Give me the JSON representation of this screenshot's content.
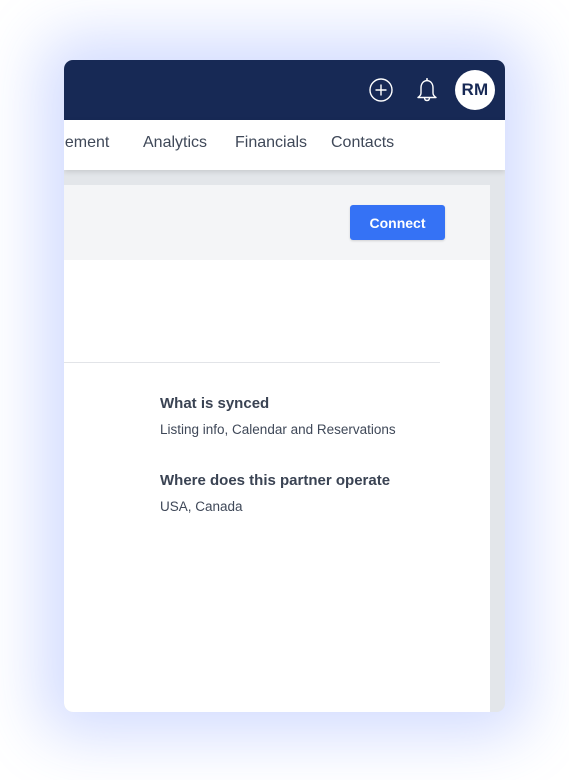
{
  "topbar": {
    "icons": {
      "add": "plus-circle-icon",
      "notifications": "bell-icon"
    },
    "avatar_initials": "RM"
  },
  "nav": {
    "items": [
      {
        "label": "gement"
      },
      {
        "label": "Analytics"
      },
      {
        "label": "Financials"
      },
      {
        "label": "Contacts"
      }
    ]
  },
  "panel": {
    "connect_label": "Connect",
    "details": [
      {
        "label": "What is synced",
        "value": "Listing info, Calendar and Reservations"
      },
      {
        "label": "Where does this partner operate",
        "value": "USA, Canada"
      }
    ]
  },
  "colors": {
    "topbar_bg": "#172955",
    "accent": "#3572f5",
    "panel_header_bg": "#f4f5f7",
    "page_bg": "#e3e6ea"
  }
}
